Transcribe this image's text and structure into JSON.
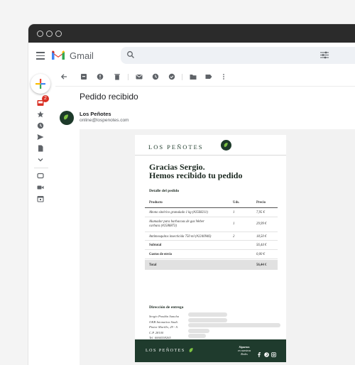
{
  "app": {
    "name": "Gmail"
  },
  "rail": {
    "inbox_badge": "2"
  },
  "email": {
    "subject": "Pedido recibido",
    "sender_name": "Los Peñotes",
    "sender_email": "online@lospenotes.com"
  },
  "message": {
    "brand": "LOS PEÑOTES",
    "greeting_line1": "Gracias Sergio.",
    "greeting_line2": "Hemos recibido tu pedido",
    "details_title": "Detalle del pedido",
    "table_headers": {
      "product": "Producto",
      "qty": "Uds.",
      "price": "Precio"
    },
    "items": [
      {
        "product": "Abono sinérico granulado 1 kg (#2568211)",
        "qty": "1",
        "price": "7,95 €"
      },
      {
        "product_line1": "Alumador para barbacoas de gas Weber",
        "product_line2": "carbura (#2586873)",
        "qty": "1",
        "price": "29,99 €"
      },
      {
        "product": "Antimosquitos insecticida 750 ml (#2240946)",
        "qty": "2",
        "price": "18,50 €"
      }
    ],
    "subtotal_label": "Subtotal",
    "subtotal_value": "56,44 €",
    "shipping_label": "Gastos de envío",
    "shipping_value": "0,00 €",
    "total_label": "Total",
    "total_value": "56,44 €",
    "address_title": "Dirección de entrega",
    "address_lines": [
      "Sergio Pondón Sancha",
      "OKB Intonatica Studi.",
      "Pintor Murillo, 29 - S.",
      "C.P. 28100",
      "Tel. 6066558265"
    ],
    "footer_brand": "LOS PEÑOTES",
    "footer_follow_line1": "Síguenos",
    "footer_follow_line2": "en nuestras Redes"
  },
  "colors": {
    "brand_green": "#1d3a2a",
    "badge_red": "#d93025"
  }
}
